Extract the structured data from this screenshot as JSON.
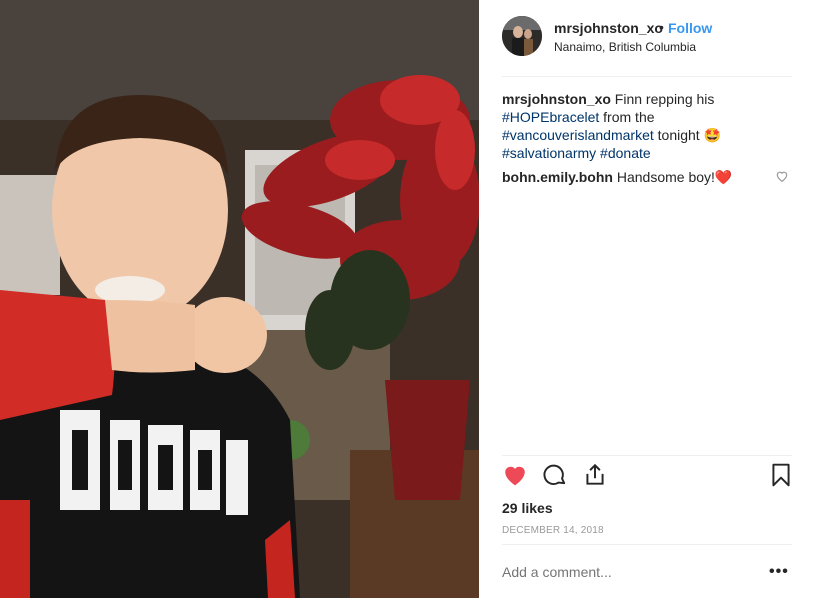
{
  "post": {
    "username": "mrsjohnston_xo",
    "separator": "•",
    "follow_label": "Follow",
    "location": "Nanaimo, British Columbia",
    "photo_icon": "photo-of-boy-with-poinsettia",
    "avatar_icon": "profile-picture"
  },
  "caption": {
    "username": "mrsjohnston_xo",
    "text_1": "Finn repping his",
    "hashtag_1": "#HOPEbracelet",
    "text_2": "from the",
    "hashtag_2": "#vancouverislandmarket",
    "text_3": "tonight",
    "emoji": "🤩",
    "hashtag_3": "#salvationarmy",
    "hashtag_4": "#donate"
  },
  "comment": {
    "username": "bohn.emily.bohn",
    "text": "Handsome boy!",
    "emoji": "❤️",
    "like_icon": "heart-outline-icon"
  },
  "actions": {
    "like_icon": "heart-filled-icon",
    "comment_icon": "comment-bubble-icon",
    "share_icon": "share-icon",
    "save_icon": "bookmark-icon",
    "like_color": "#ed4956"
  },
  "likes_label": "29 likes",
  "date_label": "DECEMBER 14, 2018",
  "add_comment": {
    "placeholder": "Add a comment...",
    "more_label": "•••"
  },
  "colors": {
    "link": "#3897f0",
    "hashtag": "#003569",
    "muted": "#999999"
  }
}
